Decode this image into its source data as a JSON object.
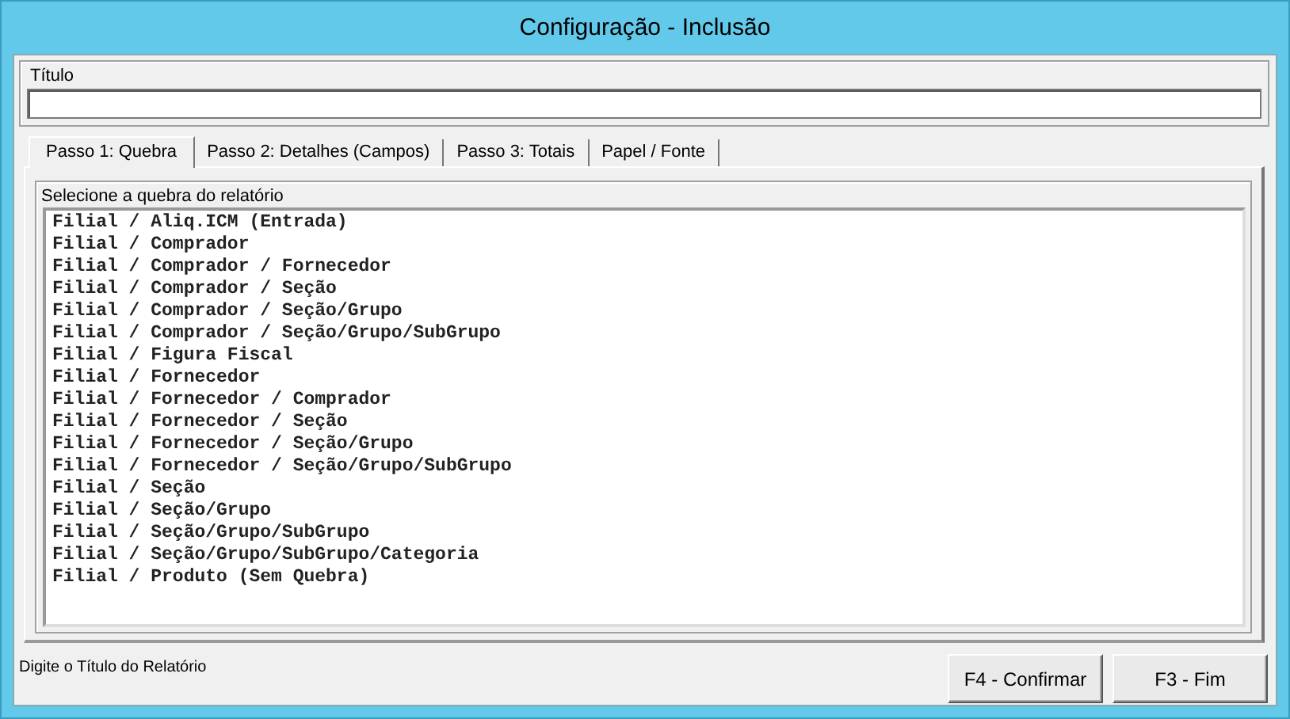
{
  "window": {
    "title": "Configuração - Inclusão"
  },
  "title_field": {
    "label": "Título"
  },
  "tabs": [
    {
      "label": "Passo 1: Quebra",
      "selected": true
    },
    {
      "label": "Passo 2: Detalhes (Campos)",
      "selected": false
    },
    {
      "label": "Passo 3: Totais",
      "selected": false
    },
    {
      "label": "Papel / Fonte",
      "selected": false
    }
  ],
  "break_list": {
    "label": "Selecione a quebra do relatório",
    "items": [
      "Filial / Aliq.ICM (Entrada)",
      "Filial / Comprador",
      "Filial / Comprador / Fornecedor",
      "Filial / Comprador / Seção",
      "Filial / Comprador / Seção/Grupo",
      "Filial / Comprador / Seção/Grupo/SubGrupo",
      "Filial / Figura Fiscal",
      "Filial / Fornecedor",
      "Filial / Fornecedor / Comprador",
      "Filial / Fornecedor / Seção",
      "Filial / Fornecedor / Seção/Grupo",
      "Filial / Fornecedor / Seção/Grupo/SubGrupo",
      "Filial / Seção",
      "Filial / Seção/Grupo",
      "Filial / Seção/Grupo/SubGrupo",
      "Filial / Seção/Grupo/SubGrupo/Categoria",
      "Filial / Produto (Sem Quebra)"
    ]
  },
  "status_bar": {
    "text": "Digite o Título do Relatório"
  },
  "buttons": [
    "F4 - Confirmar",
    "F3 - Fim"
  ]
}
